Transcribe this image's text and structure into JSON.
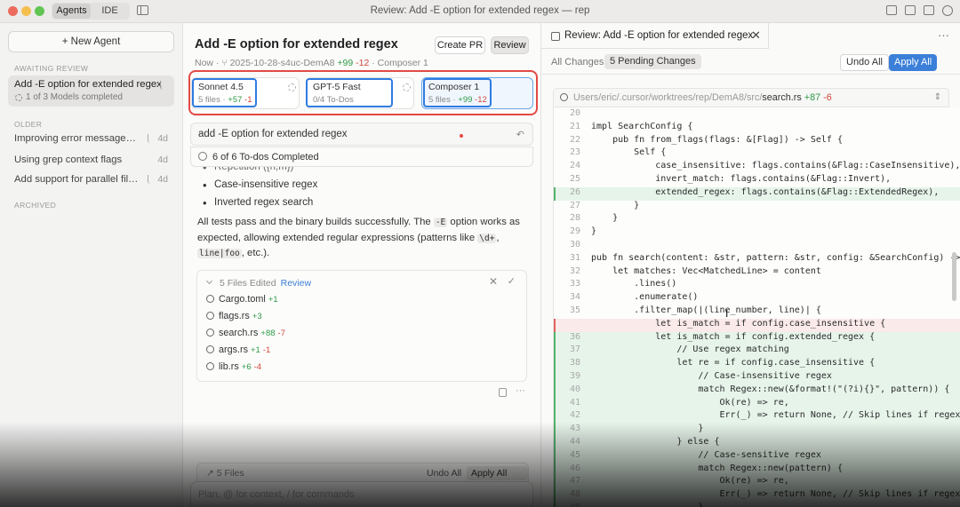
{
  "window": {
    "title": "Review: Add -E option for extended regex — rep",
    "modes": [
      "Agents",
      "IDE"
    ],
    "active_mode": "Agents"
  },
  "sidebar": {
    "new_agent": "+  New Agent",
    "awaiting_label": "AWAITING REVIEW",
    "active": {
      "title": "Add -E option for extended regex",
      "subtitle": "1 of 3 Models completed"
    },
    "older_label": "OLDER",
    "older": [
      {
        "label": "Improving error messages an...",
        "age": "4d"
      },
      {
        "label": "Using grep context flags",
        "age": "4d"
      },
      {
        "label": "Add support for parallel file p...",
        "age": "4d"
      }
    ],
    "archived_label": "ARCHIVED"
  },
  "chat": {
    "title": "Add -E option for extended regex",
    "create_pr": "Create PR",
    "review": "Review",
    "meta_time": "Now",
    "meta_branch": "2025-10-28-s4uc-DemA8",
    "meta_add": "+99",
    "meta_del": "-12",
    "meta_model": "Composer 1",
    "models": [
      {
        "name": "Sonnet 4.5",
        "files": "5 files · ",
        "add": "+57",
        "del": "-1"
      },
      {
        "name": "GPT-5 Fast",
        "files": "0/4 To-Dos",
        "add": "",
        "del": ""
      },
      {
        "name": "Composer 1",
        "files": "5 files · ",
        "add": "+99",
        "del": "-12"
      }
    ],
    "prompt": "add -E option for extended regex",
    "todos": "6 of 6 To-dos Completed",
    "bullets": [
      "Repetition ({n,m})",
      "Case-insensitive regex",
      "Inverted regex search"
    ],
    "para_1": "All tests pass and the binary builds successfully. The ",
    "para_code_1": "-E",
    "para_2": " option works as expected, allowing extended regular expressions (patterns like ",
    "para_code_2": "\\d+",
    "para_3": ", ",
    "para_code_3": "line|foo",
    "para_4": ", etc.).",
    "files_header": "5 Files Edited",
    "files_review": "Review",
    "files": [
      {
        "name": "Cargo.toml",
        "add": "+1",
        "del": ""
      },
      {
        "name": "flags.rs",
        "add": "+3",
        "del": ""
      },
      {
        "name": "search.rs",
        "add": "+88",
        "del": "-7"
      },
      {
        "name": "args.rs",
        "add": "+1",
        "del": "-1"
      },
      {
        "name": "lib.rs",
        "add": "+6",
        "del": "-4"
      }
    ],
    "bottom_files": "↗  5 Files",
    "bottom_undo": "Undo All",
    "bottom_apply": "Apply All ⌘⏎",
    "input_placeholder": "Plan, @ for context, / for commands"
  },
  "review": {
    "tab_title": "Review: Add -E option for extended regex",
    "all_changes": "All Changes",
    "pending": "5 Pending Changes",
    "undo_all": "Undo All",
    "apply_all": "Apply All",
    "file_path": "Users/eric/.cursor/worktrees/rep/DemA8/src/",
    "file_name": "search.rs",
    "file_add": "+87",
    "file_del": "-6",
    "code": [
      {
        "n": "20",
        "t": "",
        "k": "ctx"
      },
      {
        "n": "21",
        "t": "impl SearchConfig {",
        "k": "ctx"
      },
      {
        "n": "22",
        "t": "    pub fn from_flags(flags: &[Flag]) -> Self {",
        "k": "ctx"
      },
      {
        "n": "23",
        "t": "        Self {",
        "k": "ctx"
      },
      {
        "n": "24",
        "t": "            case_insensitive: flags.contains(&Flag::CaseInsensitive),",
        "k": "ctx"
      },
      {
        "n": "25",
        "t": "            invert_match: flags.contains(&Flag::Invert),",
        "k": "ctx"
      },
      {
        "n": "26",
        "t": "            extended_regex: flags.contains(&Flag::ExtendedRegex),",
        "k": "add"
      },
      {
        "n": "27",
        "t": "        }",
        "k": "ctx"
      },
      {
        "n": "28",
        "t": "    }",
        "k": "ctx"
      },
      {
        "n": "29",
        "t": "}",
        "k": "ctx"
      },
      {
        "n": "30",
        "t": "",
        "k": "ctx"
      },
      {
        "n": "31",
        "t": "pub fn search(content: &str, pattern: &str, config: &SearchConfig) ->",
        "k": "ctx"
      },
      {
        "n": "32",
        "t": "    let matches: Vec<MatchedLine> = content",
        "k": "ctx"
      },
      {
        "n": "33",
        "t": "        .lines()",
        "k": "ctx"
      },
      {
        "n": "34",
        "t": "        .enumerate()",
        "k": "ctx"
      },
      {
        "n": "35",
        "t": "        .filter_map(|(line_number, line)| {",
        "k": "ctx"
      },
      {
        "n": "",
        "t": "            let is_match = if config.case_insensitive {",
        "k": "del"
      },
      {
        "n": "36",
        "t": "            let is_match = if config.extended_regex {",
        "k": "add"
      },
      {
        "n": "37",
        "t": "                // Use regex matching",
        "k": "add"
      },
      {
        "n": "38",
        "t": "                let re = if config.case_insensitive {",
        "k": "add"
      },
      {
        "n": "39",
        "t": "                    // Case-insensitive regex",
        "k": "add"
      },
      {
        "n": "40",
        "t": "                    match Regex::new(&format!(\"(?i){}\", pattern)) {",
        "k": "add"
      },
      {
        "n": "41",
        "t": "                        Ok(re) => re,",
        "k": "add"
      },
      {
        "n": "42",
        "t": "                        Err(_) => return None, // Skip lines if regex",
        "k": "add"
      },
      {
        "n": "43",
        "t": "                    }",
        "k": "add"
      },
      {
        "n": "44",
        "t": "                } else {",
        "k": "add"
      },
      {
        "n": "45",
        "t": "                    // Case-sensitive regex",
        "k": "add"
      },
      {
        "n": "46",
        "t": "                    match Regex::new(pattern) {",
        "k": "add"
      },
      {
        "n": "47",
        "t": "                        Ok(re) => re,",
        "k": "add"
      },
      {
        "n": "48",
        "t": "                        Err(_) => return None, // Skip lines if regex",
        "k": "add"
      },
      {
        "n": "49",
        "t": "                    }",
        "k": "add"
      }
    ]
  }
}
